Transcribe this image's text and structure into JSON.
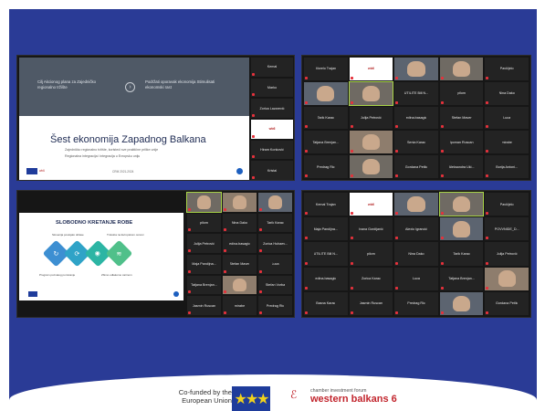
{
  "main_slide": {
    "left_text": "Cilj Akcionog plana za Zajedničko regionalno tržište",
    "right_text": "Podržati oporavak ekonomija Stimulisati ekonomski rast",
    "title": "Šest ekonomija Zapadnog Balkana",
    "subtitle1": "Zajedničko regionalno tržište, koristeći sve praktične prilike unije",
    "subtitle2": "Regionalna integracija i integracija u Evropsku uniju",
    "date": "CRM 2021-2024"
  },
  "panel1_side": [
    "Kemal",
    "Marko",
    "Zorica Lazarević",
    "Logo",
    "Hiram Konković",
    "Kristal"
  ],
  "panel2_tiles": [
    "Morelo Trajan",
    "Logo",
    "video",
    "video",
    "Pavičjelo",
    "video",
    "video",
    "UTILITE Bill N...",
    "pilom",
    "Nina Dako",
    "Tarik Karac",
    "Julija Petrović",
    "edina.basagic",
    "Stefan Maver",
    "Luca",
    "Tatjana Brenjan...",
    "video",
    "Senia Karac",
    "Ipoman Ruscan",
    "mirabe",
    "Predrag Ric",
    "video",
    "Gordana Petlic",
    "Aleksandra Uki...",
    "Borija Antoni..."
  ],
  "slide3": {
    "title": "SLOBODNO KRETANJE ROBE",
    "cap1": "Slovenija postojalo oblase",
    "cap2": "Trokotta na Evropskom osnovi",
    "cap3": "Program poznatog pomicanje",
    "cap4": "Zbimo odlakomo carinom",
    "icons": [
      "↻",
      "⟳",
      "◉",
      "≋"
    ]
  },
  "panel3_tiles": [
    "video",
    "video",
    "video",
    "pilom",
    "Nina Dako",
    "Tarik Karac",
    "Julija Petrović",
    "edina.basagic",
    "Zorica Huhaev...",
    "Maja Pandijna...",
    "Stefan Maver",
    "Luca",
    "Tatjana Brenjan...",
    "video",
    "Stefan Vorba",
    "Jasmin Ruscan",
    "mirabe",
    "Predrag Ric"
  ],
  "panel4_tiles": [
    "Kemal Trajan",
    "Logo",
    "video",
    "video",
    "Pavičjelo",
    "Maja Pandijna...",
    "Ivana Gordijanić",
    "Alexio Igrancić",
    "video",
    "POVVNIDE_D...",
    "UTILITE Bill N...",
    "pilom",
    "Nina Dako",
    "Tarik Karac",
    "Julija Petrović",
    "edina.basagic",
    "Zorica Karac",
    "Luca",
    "Tatjana Brenjan...",
    "video",
    "Basna Karac",
    "Jasmin Ruscan",
    "Predrag Ric",
    "video",
    "Gordana Petlic"
  ],
  "footer": {
    "cofunded": "Co-funded by the European Union",
    "cif_small": "chamber investment forum",
    "cif_big": "western balkans 6"
  },
  "colors": {
    "background_blue": "#2a3b96",
    "mic_muted": "#e5313b",
    "active_speaker": "#a9d548",
    "cif_red": "#c2262e"
  }
}
